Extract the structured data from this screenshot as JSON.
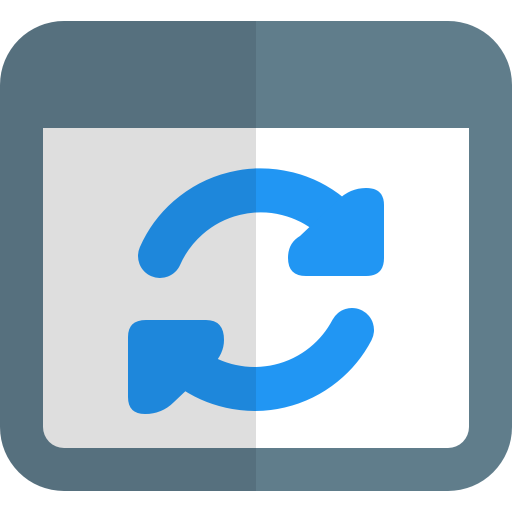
{
  "icon": {
    "name": "browser-refresh-icon",
    "colors": {
      "frame_left": "#56707E",
      "frame_right": "#607D8B",
      "content_left": "#DEDEDE",
      "content_right": "#FFFFFF",
      "arrow_left": "#1E87DB",
      "arrow_right": "#2196F3"
    }
  }
}
